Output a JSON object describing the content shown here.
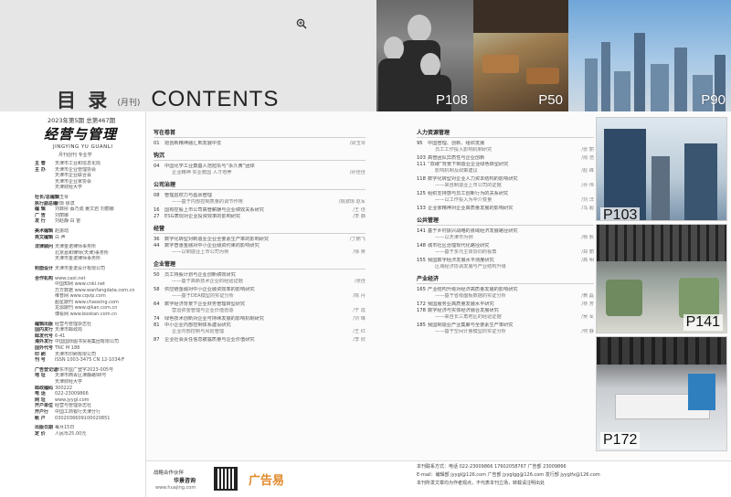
{
  "header": {
    "title_cn": "目 录",
    "frequency": "(月刊)",
    "title_en": "CONTENTS"
  },
  "top_photos": [
    {
      "label": "P108"
    },
    {
      "label": "P50"
    },
    {
      "label": "P90"
    }
  ],
  "masthead": {
    "issue": "2023年第5期  总第467期",
    "logo": "经营与管理",
    "pinyin": "JINGYING YU GUANLI",
    "sub": "月刊创刊  专业学",
    "info": [
      {
        "k": "主 管",
        "v": "天津市工业和信息化局"
      },
      {
        "k": "主 办",
        "v": "天津市企业管理协会"
      },
      {
        "k": "",
        "v": "天津市企业联合会"
      },
      {
        "k": "",
        "v": "天津市企业家协会"
      },
      {
        "k": "",
        "v": "天津财经大学"
      },
      {
        "k": "",
        "v": ""
      },
      {
        "k": "社长/总编辑",
        "v": "梁玉琴"
      },
      {
        "k": "执行副总编",
        "v": "吴琼  徐滨"
      },
      {
        "k": "编 辑",
        "v": "刘菲彤  蔡乃成  姜文岩  刘丽娜"
      },
      {
        "k": "广 告",
        "v": "刘丽娜"
      },
      {
        "k": "发 行",
        "v": "刘赵静  白 宙"
      },
      {
        "k": "",
        "v": ""
      },
      {
        "k": "美术编辑",
        "v": "赵振动"
      },
      {
        "k": "英文编辑",
        "v": "白 声"
      },
      {
        "k": "",
        "v": ""
      },
      {
        "k": "法律顾问",
        "v": "天津金诺律师事务所"
      },
      {
        "k": "",
        "v": "北京嘉和律师(天津)事务所"
      },
      {
        "k": "",
        "v": "天津市金诺律师事务所"
      },
      {
        "k": "",
        "v": ""
      },
      {
        "k": "封面设计",
        "v": "天津市金诺设计有限公司"
      },
      {
        "k": "",
        "v": ""
      },
      {
        "k": "合作机构",
        "v": "www.caol.net"
      },
      {
        "k": "",
        "v": "中国知网  www.cnki.net"
      },
      {
        "k": "",
        "v": "万方数据  www.wanfangdata.com.cn"
      },
      {
        "k": "",
        "v": "维普网  www.cqvip.com"
      },
      {
        "k": "",
        "v": "超星期刊  www.chaoxing.com"
      },
      {
        "k": "",
        "v": "龙源期刊  www.qikan.com.cn"
      },
      {
        "k": "",
        "v": "博看网  www.bookan.com.cn"
      },
      {
        "k": "",
        "v": ""
      },
      {
        "k": "编辑出版",
        "v": "经营与管理杂志社"
      },
      {
        "k": "国内发行",
        "v": "天津市邮政局"
      },
      {
        "k": "邮发代号",
        "v": "6-41"
      },
      {
        "k": "海外发行",
        "v": "中国国际图书贸易集团有限公司"
      },
      {
        "k": "国外代号",
        "v": "TNC M 188"
      },
      {
        "k": "印 刷",
        "v": "天津市印刷有限公司"
      },
      {
        "k": "刊 号",
        "v": "ISSN 1003-3475  CN 12-1034/F"
      },
      {
        "k": "",
        "v": ""
      },
      {
        "k": "广告登记证",
        "v": "津东市监广登字2023-005号"
      },
      {
        "k": "地 址",
        "v": "天津市西青区津静路98号"
      },
      {
        "k": "",
        "v": "天津财经大学"
      },
      {
        "k": "邮政编码",
        "v": "300222"
      },
      {
        "k": "电 话",
        "v": "022-23009866"
      },
      {
        "k": "网 址",
        "v": "www.jyygl.com"
      },
      {
        "k": "开户单位",
        "v": "经营与管理杂志社"
      },
      {
        "k": "开户行",
        "v": "中国工商银行天津分行"
      },
      {
        "k": "帐 户",
        "v": "0302036609100020851"
      },
      {
        "k": "",
        "v": ""
      },
      {
        "k": "出版日期",
        "v": "每月15日"
      },
      {
        "k": "定 价",
        "v": "人民币25.00元"
      }
    ]
  },
  "toc_left": [
    {
      "section": "写在卷首",
      "entries": [
        {
          "pg": "01",
          "t": "把创新精神融汇到发展中去",
          "au": "/梁玉琴",
          "sub": false
        }
      ]
    },
    {
      "section": "钩沉",
      "entries": [
        {
          "pg": "04",
          "t": "中国化学工业奠基人范旭东与“永久黄”团体",
          "au": "",
          "sub": false
        },
        {
          "pg": "",
          "t": "企业精神  实业救国  人才培养",
          "au": "/孙佳佳",
          "sub": true
        }
      ]
    },
    {
      "section": "公司治理",
      "entries": [
        {
          "pg": "08",
          "t": "管理层权力与盈余管理",
          "au": "",
          "sub": false
        },
        {
          "pg": "",
          "t": "——基于内部控制质量的调节作用",
          "au": "/姚淑琼 赵军",
          "sub": true
        },
        {
          "pg": "16",
          "t": "国有控股上市公司高管薪酬与企业绩效关系研究",
          "au": "/王 佳",
          "sub": false
        },
        {
          "pg": "27",
          "t": "ESG表现对企业投资效率的影响研究",
          "au": "/李 静",
          "sub": false
        }
      ]
    },
    {
      "section": "经营",
      "entries": [
        {
          "pg": "36",
          "t": "数字化转型对制造业企业全要素生产率的影响研究",
          "au": "/丁鹏飞",
          "sub": false
        },
        {
          "pg": "44",
          "t": "数字普惠金融对中小企业融资约束的影响研究",
          "au": "",
          "sub": false
        },
        {
          "pg": "",
          "t": "——以制造业上市公司为例",
          "au": "/徐 英",
          "sub": true
        }
      ]
    },
    {
      "section": "企业管理",
      "entries": [
        {
          "pg": "50",
          "t": "员工持股计划与企业创新绩效研究",
          "au": "",
          "sub": false
        },
        {
          "pg": "",
          "t": "——基于高新技术企业的经验证据",
          "au": "/张佳",
          "sub": true
        },
        {
          "pg": "58",
          "t": "供应链金融对中小企业融资效率的影响研究",
          "au": "",
          "sub": false
        },
        {
          "pg": "",
          "t": "——基于DEA模型的实证分析",
          "au": "/陈 丹",
          "sub": true
        },
        {
          "pg": "64",
          "t": "数字经济背景下企业财务管理转型研究",
          "au": "",
          "sub": false
        },
        {
          "pg": "",
          "t": "营运资金管理与企业价值创造",
          "au": "/于 成",
          "sub": true
        },
        {
          "pg": "74",
          "t": "绿色技术创新对企业可持续发展的影响机制研究",
          "au": "/刘 琳",
          "sub": false
        },
        {
          "pg": "81",
          "t": "中小企业内部控制体系建设研究",
          "au": "",
          "sub": false
        },
        {
          "pg": "",
          "t": "企业内部控制与风险管理",
          "au": "/王 红",
          "sub": true
        },
        {
          "pg": "87",
          "t": "企业社会责任信息披露质量与企业价值研究",
          "au": "/李 欣",
          "sub": false
        }
      ]
    }
  ],
  "toc_right": [
    {
      "section": "人力资源管理",
      "entries": [
        {
          "pg": "95",
          "t": "中国管理、创新、组织发展",
          "au": "",
          "sub": false
        },
        {
          "pg": "",
          "t": "员工工作投入影响机制研究",
          "au": "/张 丽",
          "sub": true
        },
        {
          "pg": "103",
          "t": "高管团队异质性与企业创新",
          "au": "/周 浩",
          "sub": false
        },
        {
          "pg": "111",
          "t": "“双碳”背景下制造业企业绿色转型研究",
          "au": "",
          "sub": false
        },
        {
          "pg": "",
          "t": "影响机制及政策建议",
          "au": "/赵 峰",
          "sub": true
        },
        {
          "pg": "118",
          "t": "数字化转型对企业人力资本结构的影响研究",
          "au": "",
          "sub": false
        },
        {
          "pg": "",
          "t": "——来自制造业上市公司的证据",
          "au": "/孙 伟",
          "sub": true
        },
        {
          "pg": "125",
          "t": "组织支持感与员工创新行为的关系研究",
          "au": "",
          "sub": false
        },
        {
          "pg": "",
          "t": "——以工作投入为中介变量",
          "au": "/刘 洋",
          "sub": true
        },
        {
          "pg": "133",
          "t": "企业家精神对企业高质量发展的影响研究",
          "au": "/马 超",
          "sub": false
        }
      ]
    },
    {
      "section": "公共管理",
      "entries": [
        {
          "pg": "141",
          "t": "基于乡村振兴战略的县域经济发展路径研究",
          "au": "",
          "sub": false
        },
        {
          "pg": "",
          "t": "——以天津市为例",
          "au": "/杨 帆",
          "sub": true
        },
        {
          "pg": "148",
          "t": "城市社区治理现代化路径研究",
          "au": "",
          "sub": false
        },
        {
          "pg": "",
          "t": "——基于多元主体协同的视角",
          "au": "/郑 丽",
          "sub": true
        },
        {
          "pg": "155",
          "t": "我国数字经济发展水平测度研究",
          "au": "/高 明",
          "sub": false
        },
        {
          "pg": "",
          "t": "区域经济协调发展与产业结构升级",
          "au": "",
          "sub": true
        }
      ]
    },
    {
      "section": "产业经济",
      "entries": [
        {
          "pg": "165",
          "t": "产业结构升级对经济高质量发展的影响研究",
          "au": "",
          "sub": false
        },
        {
          "pg": "",
          "t": "——基于省级面板数据的实证分析",
          "au": "/黄 磊",
          "sub": true
        },
        {
          "pg": "172",
          "t": "我国服务业高质量发展水平研究",
          "au": "/林 芳",
          "sub": false
        },
        {
          "pg": "178",
          "t": "数字经济与实体经济融合发展研究",
          "au": "",
          "sub": false
        },
        {
          "pg": "",
          "t": "——来自长三角地区的经验证据",
          "au": "/吴 军",
          "sub": true
        },
        {
          "pg": "185",
          "t": "我国制造业产业集聚与全要素生产率研究",
          "au": "",
          "sub": false
        },
        {
          "pg": "",
          "t": "——基于空间计量模型的实证分析",
          "au": "/何 静",
          "sub": true
        }
      ]
    }
  ],
  "right_photos": [
    {
      "label": "P103"
    },
    {
      "label": "P141"
    },
    {
      "label": "P172"
    }
  ],
  "footer": {
    "partner_label": "战略合作伙伴",
    "partner_name": "华景咨询",
    "partner_site": "www.huajing.com",
    "brand": "广告易",
    "contact": [
      "本刊联系方式：电话 022-23009866  17602058767  广告部 23009866",
      "E-mail：编辑部 jyygl@126.com  广告部 jyyglgg@126.com  发行部 jyyglfx@126.com",
      "本刊所发文章均为作者观点，不代表本刊立场，转载请注明出处"
    ]
  }
}
